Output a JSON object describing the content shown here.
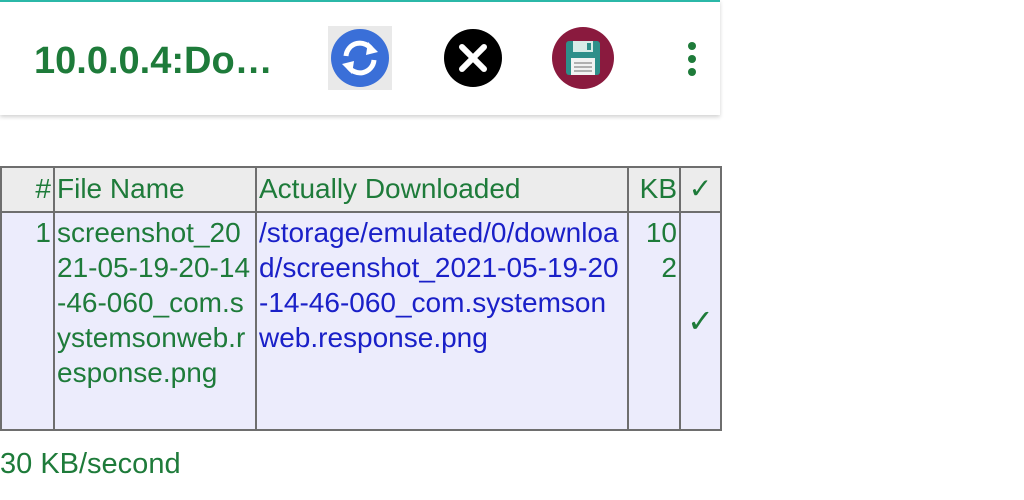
{
  "appbar": {
    "title": "10.0.0.4:Do…",
    "icons": [
      "refresh-icon",
      "close-icon",
      "save-icon",
      "more-vertical-icon"
    ]
  },
  "table": {
    "headers": {
      "num": "#",
      "file_name": "File Name",
      "downloaded": "Actually Downloaded",
      "kb": "KB",
      "check": "✓"
    },
    "rows": [
      {
        "num": "1",
        "file_name": "screenshot_2021-05-19-20-14-46-060_com.systemsonweb.response.png",
        "downloaded": "/storage/emulated/0/download/screenshot_2021-05-19-20-14-46-060_com.systemsonweb.response.png",
        "kb": "102",
        "check": "✓"
      }
    ]
  },
  "status": {
    "speed": "30 KB/second"
  },
  "colors": {
    "text_green": "#1e7b3a",
    "link_blue": "#1a20c8",
    "accent_teal": "#2bb8a8",
    "refresh_blue": "#3a6fd8",
    "save_maroon": "#8a1a3e"
  }
}
